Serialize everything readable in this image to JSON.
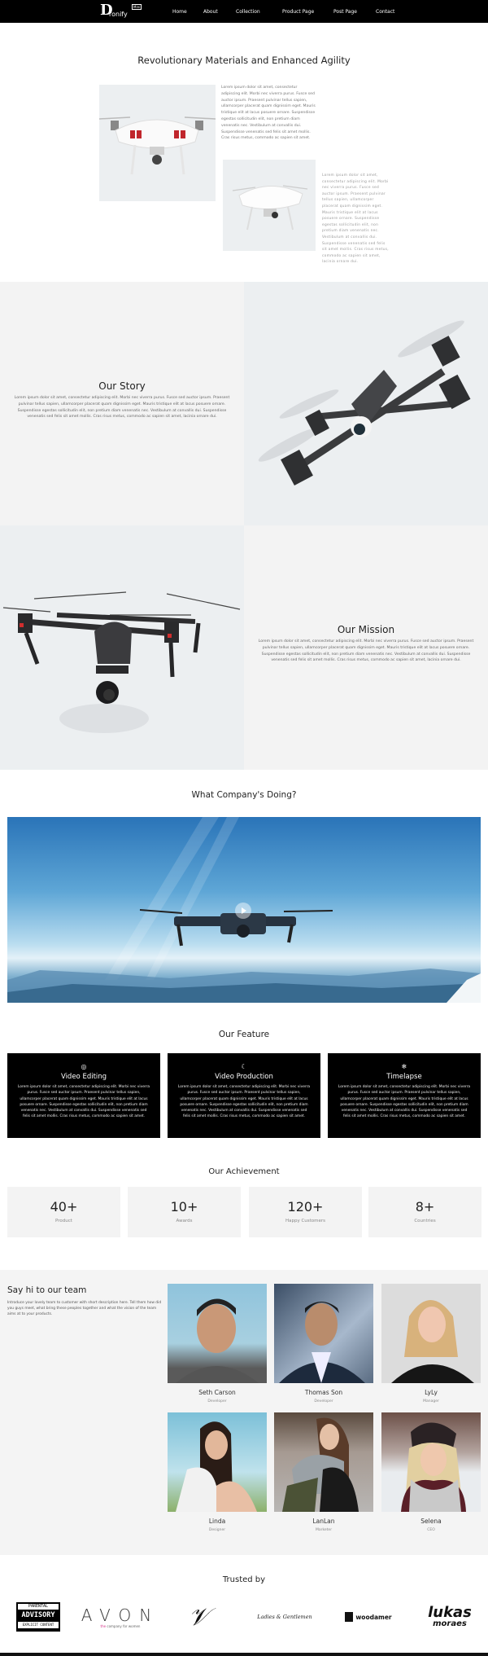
{
  "nav": {
    "logo_mark": "D",
    "logo_word": "ronify",
    "logo_badge": "Mini",
    "links": [
      "Home",
      "About",
      "Collection",
      "Product Page",
      "Post Page",
      "Contact"
    ]
  },
  "intro": {
    "title": "Revolutionary Materials and Enhanced Agility",
    "paragraph_1": "Lorem ipsum dolor sit amet, consectetur adipiscing elit. Morbi nec viverra purus. Fusce sed auctor ipsum. Praesent pulvinar tellus sapien, ullamcorper placerat quam dignissim eget. Mauris tristique elit at lacus posuere ornare. Suspendisse egestas sollicitudin elit, non pretium diam venenatis nec. Vestibulum at convallis dui. Suspendisse venenatis sed felis sit amet mollis. Cras risus metus, commodo ac sapien sit amet.",
    "paragraph_2": "Lorem ipsum dolor sit amet, consectetur adipiscing elit. Morbi nec viverra purus. Fusce sed auctor ipsum. Praesent pulvinar tellus sapien, ullamcorper placerat quam dignissim eget. Mauris tristique elit at lacus posuere ornare. Suspendisse egestas sollicitudin elit, non pretium diam venenatis nec. Vestibulum at convallis dui. Suspendisse venenatis sed felis sit amet mollis. Cras risus metus, commodo ac sapien sit amet, lacinia ornare dui."
  },
  "story": {
    "title": "Our Story",
    "text": "Lorem ipsum dolor sit amet, consectetur adipiscing elit. Morbi nec viverra purus. Fusce sed auctor ipsum. Praesent pulvinar tellus sapien, ullamcorper placerat quam dignissim eget. Mauris tristique elit at lacus posuere ornare. Suspendisse egestas sollicitudin elit, non pretium diam venenatis nec. Vestibulum at convallis dui. Suspendisse venenatis sed felis sit amet mollis. Cras risus metus, commodo ac sapien sit amet, lacinia ornare dui."
  },
  "mission": {
    "title": "Our Mission",
    "text": "Lorem ipsum dolor sit amet, consectetur adipiscing elit. Morbi nec viverra purus. Fusce sed auctor ipsum. Praesent pulvinar tellus sapien, ullamcorper placerat quam dignissim eget. Mauris tristique elit at lacus posuere ornare. Suspendisse egestas sollicitudin elit, non pretium diam venenatis nec. Vestibulum at convallis dui. Suspendisse venenatis sed felis sit amet mollis. Cras risus metus, commodo ac sapien sit amet, lacinia ornare dui."
  },
  "video": {
    "title": "What Company's Doing?",
    "play_icon": "play-icon"
  },
  "features": {
    "title": "Our Feature",
    "items": [
      {
        "icon": "◎",
        "title": "Video Editing",
        "text": "Lorem ipsum dolor sit amet, consectetur adipiscing elit. Morbi nec viverra purus. Fusce sed auctor ipsum. Praesent pulvinar tellus sapien, ullamcorper placerat quam dignissim eget. Mauris tristique elit at lacus posuere ornare. Suspendisse egestas sollicitudin elit, non pretium diam venenatis nec. Vestibulum at convallis dui. Suspendisse venenatis sed felis sit amet mollis. Cras risus metus, commodo ac sapien sit amet."
      },
      {
        "icon": "☾",
        "title": "Video Production",
        "text": "Lorem ipsum dolor sit amet, consectetur adipiscing elit. Morbi nec viverra purus. Fusce sed auctor ipsum. Praesent pulvinar tellus sapien, ullamcorper placerat quam dignissim eget. Mauris tristique elit at lacus posuere ornare. Suspendisse egestas sollicitudin elit, non pretium diam venenatis nec. Vestibulum at convallis dui. Suspendisse venenatis sed felis sit amet mollis. Cras risus metus, commodo ac sapien sit amet."
      },
      {
        "icon": "❄",
        "title": "Timelapse",
        "text": "Lorem ipsum dolor sit amet, consectetur adipiscing elit. Morbi nec viverra purus. Fusce sed auctor ipsum. Praesent pulvinar tellus sapien, ullamcorper placerat quam dignissim eget. Mauris tristique elit at lacus posuere ornare. Suspendisse egestas sollicitudin elit, non pretium diam venenatis nec. Vestibulum at convallis dui. Suspendisse venenatis sed felis sit amet mollis. Cras risus metus, commodo ac sapien sit amet."
      }
    ]
  },
  "achievements": {
    "title": "Our Achievement",
    "items": [
      {
        "value": "40+",
        "label": "Product"
      },
      {
        "value": "10+",
        "label": "Awards"
      },
      {
        "value": "120+",
        "label": "Happy Customers"
      },
      {
        "value": "8+",
        "label": "Countries"
      }
    ]
  },
  "team": {
    "title": "Say hi to our team",
    "intro": "Introduce your lovely team to customer with short description here. Tell them how did you guys meet, what bring these peoples together and what the vision of the team aims at to your products.",
    "members": [
      {
        "name": "Seth Carson",
        "role": "Developer"
      },
      {
        "name": "Thomas Son",
        "role": "Developer"
      },
      {
        "name": "LyLy",
        "role": "Manager"
      },
      {
        "name": "Linda",
        "role": "Designer"
      },
      {
        "name": "LanLan",
        "role": "Marketer"
      },
      {
        "name": "Selena",
        "role": "CEO"
      }
    ]
  },
  "trusted": {
    "title": "Trusted by",
    "logos": [
      {
        "line1": "PARENTAL",
        "line2": "ADVISORY",
        "line3": "EXPLICIT CONTENT"
      },
      {
        "word": "AVON",
        "tag_accent": "the",
        "tag": " company for women"
      },
      {
        "mark": "𝒱"
      },
      {
        "word": "Ladies & Gentlemen"
      },
      {
        "word": "woodamer"
      },
      {
        "line1": "lukas",
        "line2": "moraes"
      }
    ]
  },
  "colors": {
    "nav_bg": "#000000",
    "panel_gray": "#f3f3f3",
    "product_bg": "#eceff1",
    "avon_accent": "#d6338a"
  }
}
